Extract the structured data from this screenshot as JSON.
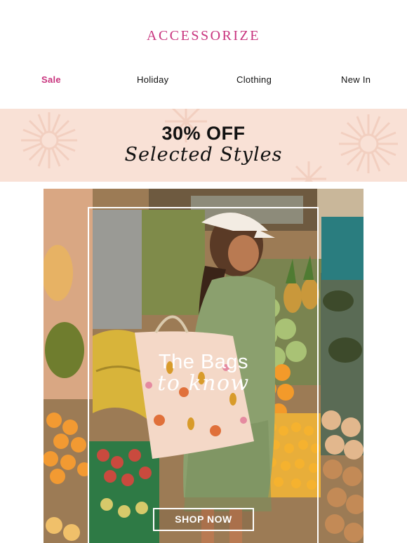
{
  "brand": {
    "logo_text": "ACCESSORIZE",
    "color": "#c8347e"
  },
  "nav": {
    "items": [
      {
        "label": "Sale"
      },
      {
        "label": "Holiday"
      },
      {
        "label": "Clothing"
      },
      {
        "label": "New In"
      }
    ]
  },
  "promo": {
    "headline": "30% OFF",
    "subline": "Selected Styles",
    "background": "#f9e1d6"
  },
  "hero": {
    "title": "The Bags",
    "subtitle": "to know",
    "cta_label": "SHOP NOW"
  }
}
